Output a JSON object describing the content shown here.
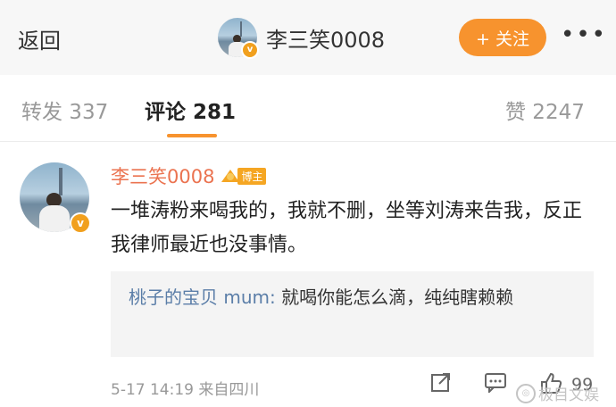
{
  "topbar": {
    "back_label": "返回",
    "title": "李三笑0008",
    "follow_label": "+ 关注",
    "more_label": "•••"
  },
  "tabs": [
    {
      "label": "转发 337"
    },
    {
      "label": "评论 281",
      "active": true
    },
    {
      "label": "赞 2247"
    }
  ],
  "comment": {
    "username": "李三笑0008",
    "badge": "博主",
    "text": "一堆涛粉来喝我的，我就不删，坐等刘涛来告我，反正我律师最近也没事情。",
    "reply": {
      "user": "桃子的宝贝 mum:",
      "text": "就喝你能怎么滴，纯纯瞎赖赖"
    },
    "time": "5-17 14:19",
    "location": "来自四川",
    "like_count": "99"
  },
  "watermark": "极目文娱",
  "colors": {
    "accent": "#f7932e",
    "username": "#eb7350",
    "reply_user": "#5b7ea8"
  },
  "icons": [
    "share-icon",
    "comment-icon",
    "like-icon",
    "verified-badge-icon",
    "crown-icon"
  ]
}
